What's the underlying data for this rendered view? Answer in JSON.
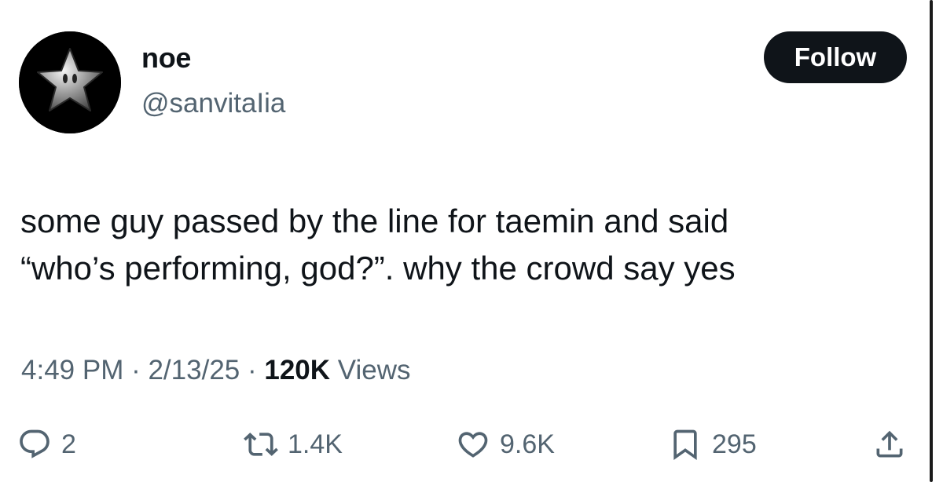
{
  "author": {
    "display_name": "noe",
    "handle": "@sanvitaIia",
    "avatar_icon": "star-icon"
  },
  "follow_label": "Follow",
  "tweet": {
    "lines": [
      "some guy passed by the line for taemin and said",
      "“who’s performing, god?”. why the crowd say yes"
    ]
  },
  "meta": {
    "time": "4:49 PM",
    "sep1": " · ",
    "date": "2/13/25",
    "sep2": " · ",
    "views_count": "120K",
    "views_label": " Views"
  },
  "actions": {
    "reply": {
      "icon": "reply-icon",
      "count": "2"
    },
    "retweet": {
      "icon": "retweet-icon",
      "count": "1.4K"
    },
    "like": {
      "icon": "heart-icon",
      "count": "9.6K"
    },
    "bookmark": {
      "icon": "bookmark-icon",
      "count": "295"
    },
    "share": {
      "icon": "share-icon"
    }
  },
  "colors": {
    "text": "#0f1419",
    "secondary": "#536471",
    "button_bg": "#0f1419",
    "button_text": "#ffffff"
  }
}
